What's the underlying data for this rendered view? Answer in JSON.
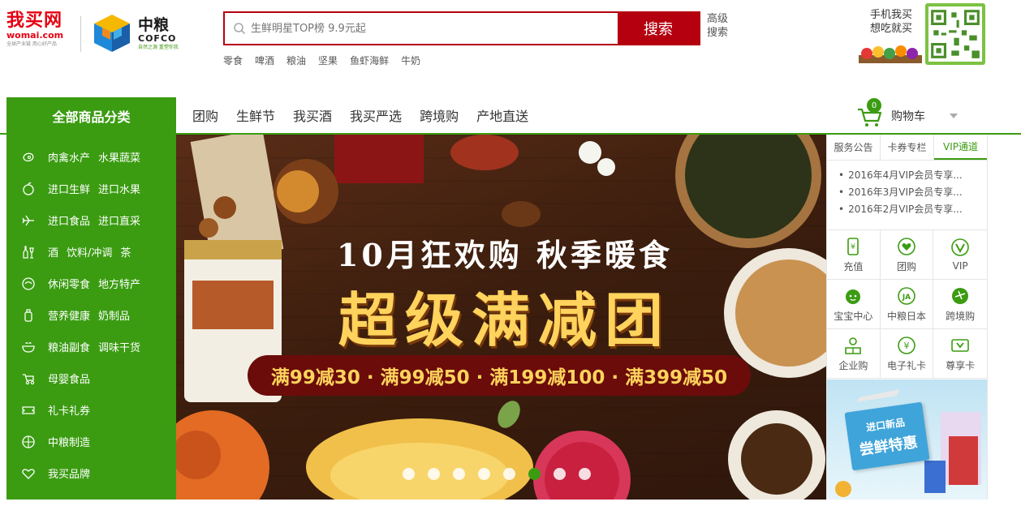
{
  "logo": {
    "womai_name": "我买网",
    "womai_domain": "womai.com",
    "womai_slogan": "全球产业链 用心好产品",
    "cofco_cn": "中粮",
    "cofco_en": "COFCO",
    "cofco_tag": "自然之源 重塑你我"
  },
  "search": {
    "placeholder": "生鲜明星TOP榜 9.9元起",
    "button": "搜索",
    "advanced": "高级搜索",
    "hot_words": [
      "零食",
      "啤酒",
      "粮油",
      "坚果",
      "鱼虾海鲜",
      "牛奶"
    ]
  },
  "qr": {
    "text_line1": "手机我买",
    "text_line2": "想吃就买"
  },
  "nav": {
    "all_categories": "全部商品分类",
    "links": [
      "团购",
      "生鲜节",
      "我买酒",
      "我买严选",
      "跨境购",
      "产地直送"
    ],
    "cart_count": "0",
    "cart_label": "购物车"
  },
  "categories": [
    {
      "icon": "meat-icon",
      "labels": [
        "肉禽水产",
        "水果蔬菜"
      ]
    },
    {
      "icon": "apple-icon",
      "labels": [
        "进口生鲜",
        "进口水果"
      ]
    },
    {
      "icon": "plane-icon",
      "labels": [
        "进口食品",
        "进口直采"
      ]
    },
    {
      "icon": "wine-icon",
      "labels": [
        "酒",
        "饮料/冲调",
        "茶"
      ]
    },
    {
      "icon": "snack-icon",
      "labels": [
        "休闲零食",
        "地方特产"
      ]
    },
    {
      "icon": "bottle-icon",
      "labels": [
        "营养健康",
        "奶制品"
      ]
    },
    {
      "icon": "bowl-icon",
      "labels": [
        "粮油副食",
        "调味干货"
      ]
    },
    {
      "icon": "stroller-icon",
      "labels": [
        "母婴食品"
      ]
    },
    {
      "icon": "ticket-icon",
      "labels": [
        "礼卡礼券"
      ]
    },
    {
      "icon": "globe-icon",
      "labels": [
        "中粮制造"
      ]
    },
    {
      "icon": "heart-icon",
      "labels": [
        "我买品牌"
      ]
    }
  ],
  "banner": {
    "title1": "10月狂欢购 秋季暖食",
    "title2": "超级满减团",
    "promo": "满99减30 · 满99减50 · 满199减100 · 满399减50",
    "slide_count": 8,
    "active_slide": 6
  },
  "right_panel": {
    "tabs": [
      "服务公告",
      "卡券专栏",
      "VIP通道"
    ],
    "active_tab": 2,
    "news": [
      "2016年4月VIP会员专享...",
      "2016年3月VIP会员专享...",
      "2016年2月VIP会员专享..."
    ],
    "services": [
      {
        "icon": "phone-recharge-icon",
        "label": "充值"
      },
      {
        "icon": "group-buy-icon",
        "label": "团购"
      },
      {
        "icon": "vip-icon",
        "label": "VIP"
      },
      {
        "icon": "baby-icon",
        "label": "宝宝中心"
      },
      {
        "icon": "japan-icon",
        "label": "中粮日本"
      },
      {
        "icon": "crossborder-icon",
        "label": "跨境购"
      },
      {
        "icon": "enterprise-icon",
        "label": "企业购"
      },
      {
        "icon": "gift-card-icon",
        "label": "电子礼卡"
      },
      {
        "icon": "premium-card-icon",
        "label": "尊享卡"
      }
    ],
    "ad_line1": "进口新品",
    "ad_line2": "尝鲜特惠"
  },
  "colors": {
    "brand_green": "#3b9c12",
    "brand_red": "#b5000f",
    "banner_gold": "#ffd35c"
  }
}
